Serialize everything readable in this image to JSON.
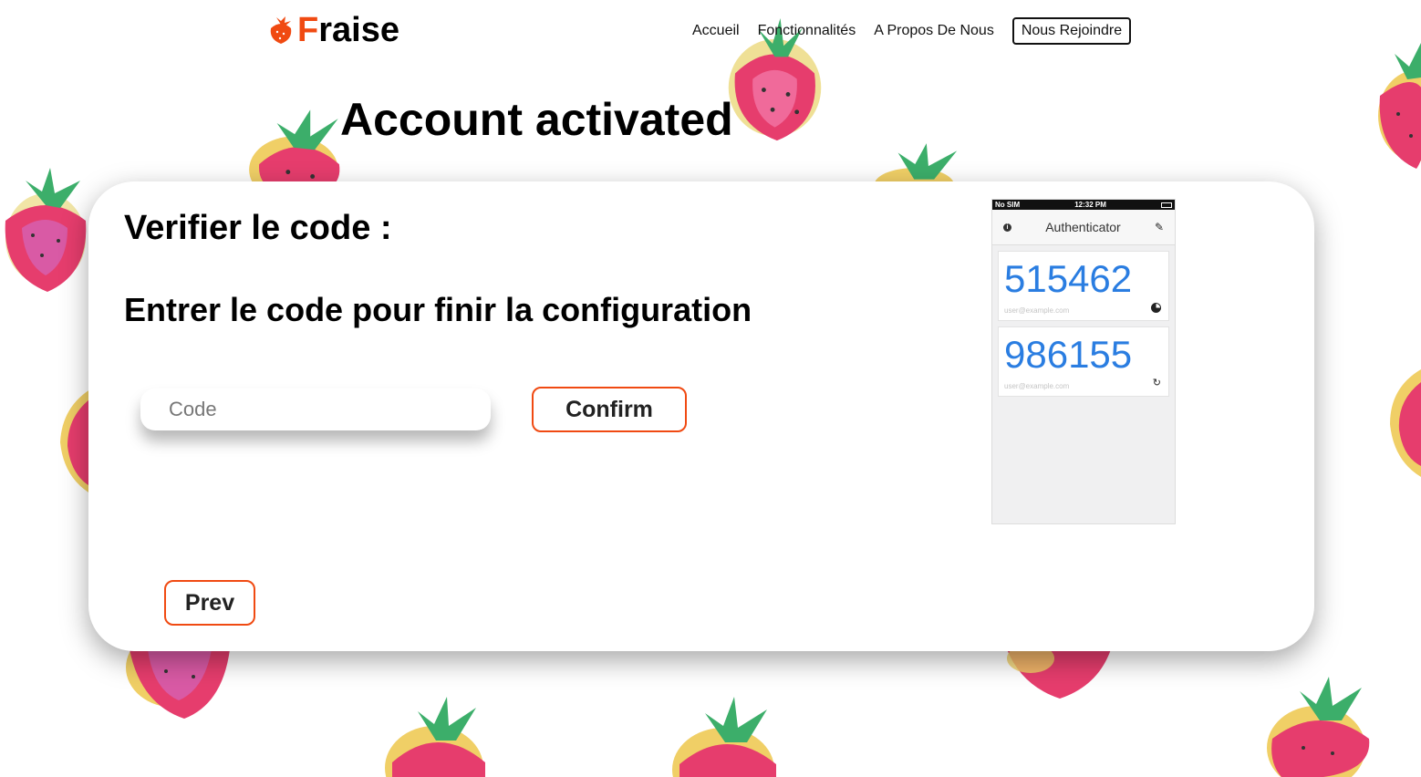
{
  "header": {
    "brand_first": "F",
    "brand_rest": "raise",
    "nav": [
      {
        "label": "Accueil"
      },
      {
        "label": "Fonctionnalités"
      },
      {
        "label": "A Propos De Nous"
      }
    ],
    "join_label": "Nous Rejoindre"
  },
  "page_title": "Account activated",
  "card": {
    "verify_title": "Verifier le code :",
    "instruction": "Entrer le code pour finir la configuration",
    "code_placeholder": "Code",
    "confirm_label": "Confirm",
    "prev_label": "Prev"
  },
  "phone": {
    "carrier": "No SIM",
    "time": "12:32 PM",
    "app_title": "Authenticator",
    "codes": [
      {
        "code": "515462",
        "account": "user@example.com",
        "icon": "timer-icon"
      },
      {
        "code": "986155",
        "account": "user@example.com",
        "icon": "refresh-icon"
      }
    ]
  },
  "colors": {
    "accent": "#f04a12",
    "otp_blue": "#2a7de1"
  }
}
